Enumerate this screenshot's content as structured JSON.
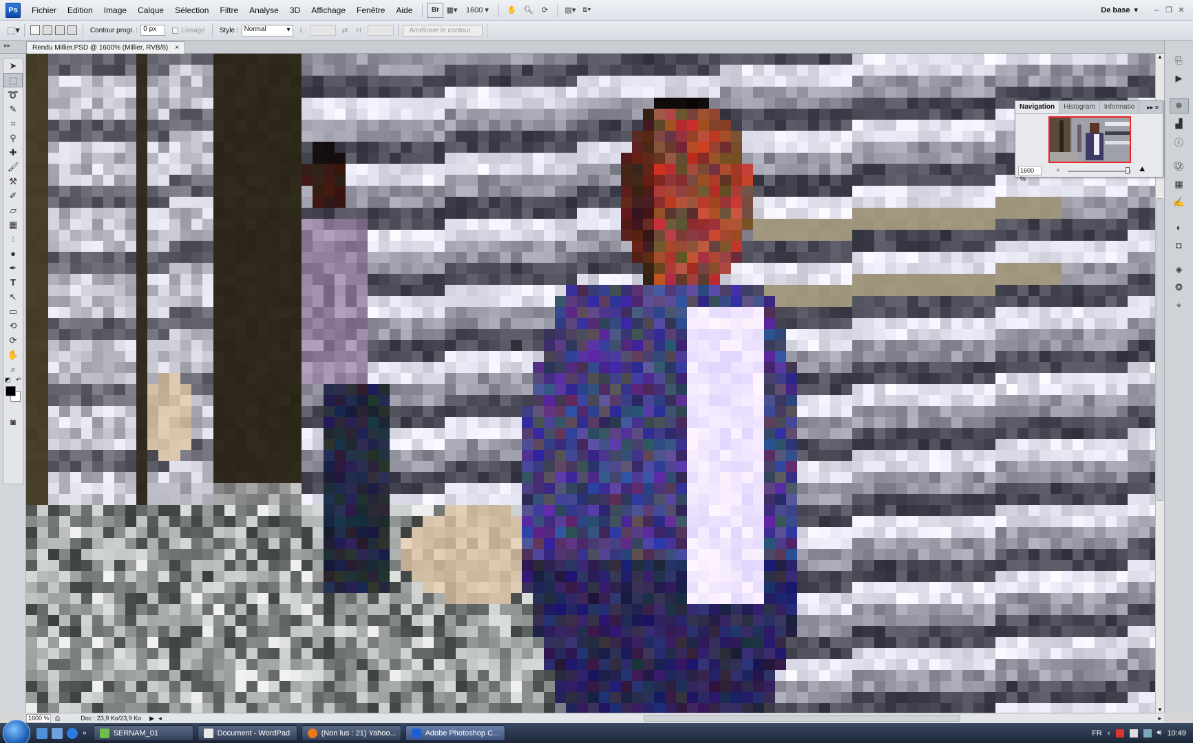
{
  "app": {
    "logo": "Ps"
  },
  "menu": [
    "Fichier",
    "Edition",
    "Image",
    "Calque",
    "Sélection",
    "Filtre",
    "Analyse",
    "3D",
    "Affichage",
    "Fenêtre",
    "Aide"
  ],
  "menubar": {
    "bridge_label": "Br",
    "zoom_level": "1600",
    "workspace": "De base"
  },
  "options": {
    "feather_label": "Contour progr. :",
    "feather_value": "0 px",
    "antialias_label": "Lissage",
    "style_label": "Style :",
    "style_value": "Normal",
    "width_label": "L :",
    "height_label": "H :",
    "refine_button": "Améliorer le contour..."
  },
  "document": {
    "tab_title": "Rendu Millier.PSD @ 1600% (Millier, RVB/8)",
    "close_glyph": "×"
  },
  "navigator": {
    "tabs": [
      "Navigation",
      "Histogram",
      "Informatio"
    ],
    "zoom": "1600 %"
  },
  "status": {
    "zoom": "1600 %",
    "doc_info": "Doc : 23,9 Ko/23,9 Ko"
  },
  "taskbar": {
    "tasks": [
      "SERNAM_01",
      "Document - WordPad",
      "(Non lus : 21) Yahoo...",
      "Adobe Photoshop C..."
    ],
    "language": "FR",
    "clock": "10:49"
  },
  "colors": {
    "accent": "#1c5fcf",
    "foreground": "#000000",
    "background": "#ffffff"
  }
}
